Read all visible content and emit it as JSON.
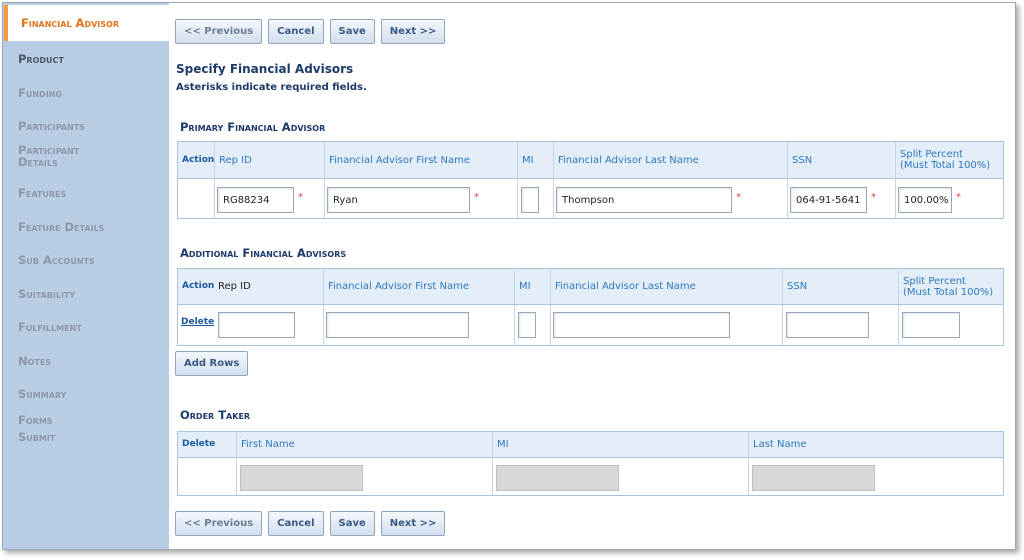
{
  "sidebar": {
    "items": [
      {
        "label": "Financial Advisor"
      },
      {
        "label": "Product"
      },
      {
        "label": "Funding"
      },
      {
        "label": "Participants"
      },
      {
        "label": "Participant Details"
      },
      {
        "label": "Features"
      },
      {
        "label": "Feature Details"
      },
      {
        "label": "Sub Accounts"
      },
      {
        "label": "Suitability"
      },
      {
        "label": "Fulfillment"
      },
      {
        "label": "Notes"
      },
      {
        "label": "Summary"
      },
      {
        "label": "Forms"
      },
      {
        "label": "Submit"
      }
    ]
  },
  "toolbar": {
    "previous": "<< Previous",
    "cancel": "Cancel",
    "save": "Save",
    "next": "Next >>"
  },
  "page": {
    "title": "Specify Financial Advisors",
    "subtitle": "Asterisks indicate required fields."
  },
  "primary": {
    "heading": "Primary Financial Advisor",
    "columns": {
      "action": "Action",
      "rep_id": "Rep ID",
      "first_name": "Financial Advisor First Name",
      "mi": "MI",
      "last_name": "Financial Advisor Last Name",
      "ssn": "SSN",
      "split_line1": "Split Percent",
      "split_line2": "(Must Total 100%)"
    },
    "row": {
      "rep_id": "RG88234",
      "first_name": "Ryan",
      "mi": "",
      "last_name": "Thompson",
      "ssn": "064-91-5641",
      "split": "100.00%"
    },
    "required_mark": "*"
  },
  "additional": {
    "heading": "Additional Financial Advisors",
    "columns": {
      "action": "Action",
      "rep_id": "Rep ID",
      "first_name": "Financial Advisor First Name",
      "mi": "MI",
      "last_name": "Financial Advisor Last Name",
      "ssn": "SSN",
      "split_line1": "Split Percent",
      "split_line2": "(Must Total 100%)"
    },
    "delete_label": "Delete",
    "add_rows_label": "Add Rows"
  },
  "order_taker": {
    "heading": "Order Taker",
    "columns": {
      "delete": "Delete",
      "first_name": "First Name",
      "mi": "MI",
      "last_name": "Last Name"
    }
  }
}
